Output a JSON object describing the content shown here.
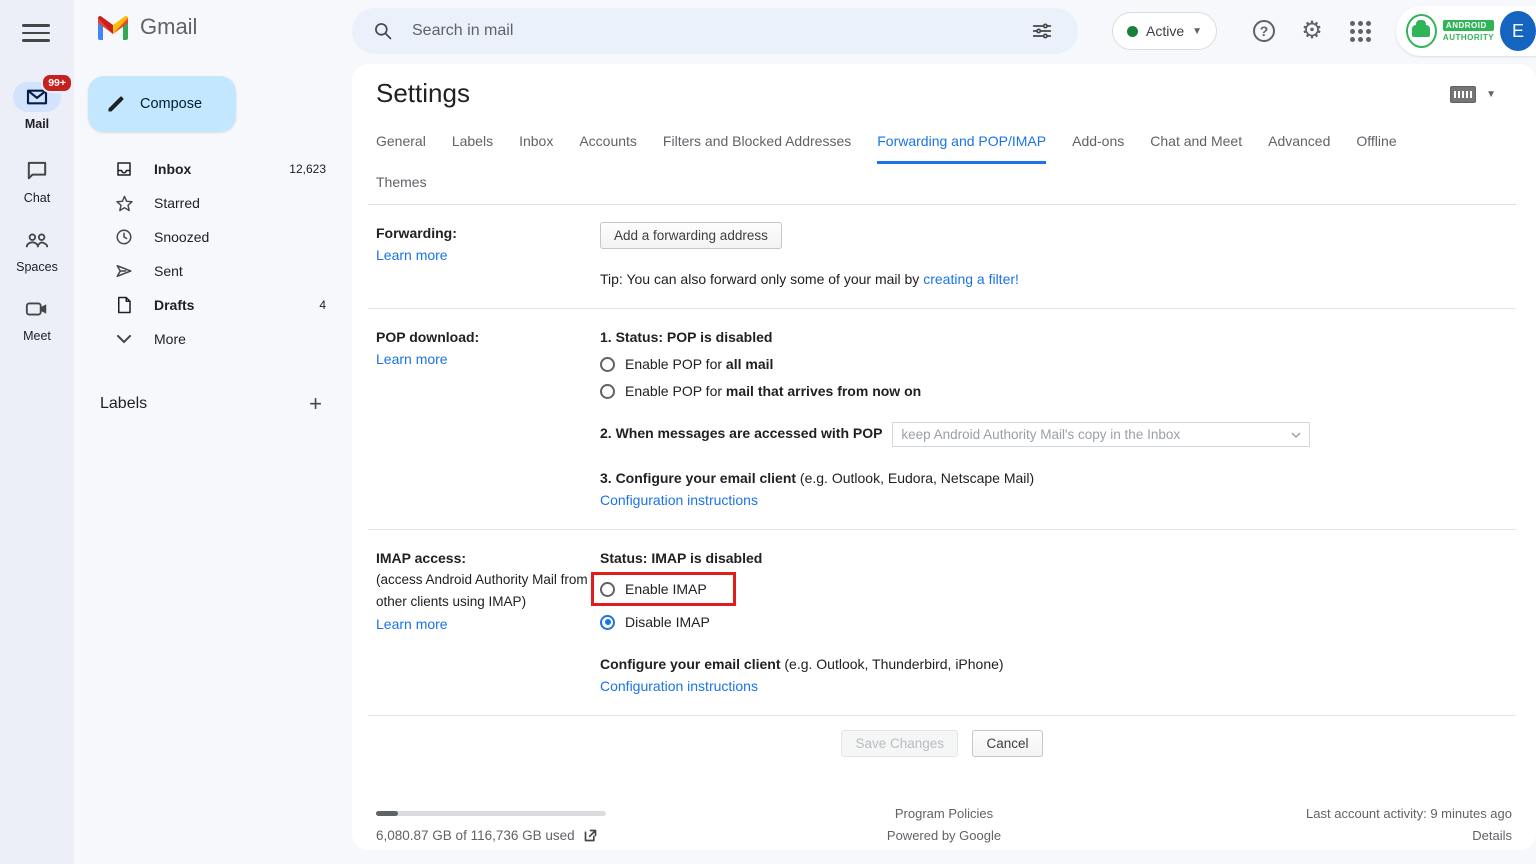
{
  "colors": {
    "accent_blue": "#1a73e8",
    "compose_blue": "#c2e7ff",
    "active_green": "#188038",
    "badge_red": "#c5221f",
    "highlight_red": "#e01d1d",
    "avatar_blue": "#1565c0",
    "brand_green": "#2fb457",
    "background": "#f6f8fc"
  },
  "brand": {
    "name": "Gmail"
  },
  "topbar": {
    "search_placeholder": "Search in mail",
    "active_label": "Active",
    "brand_line1": "ANDROID",
    "brand_line2": "AUTHORITY",
    "avatar_initial": "E"
  },
  "rail": {
    "mail_label": "Mail",
    "mail_badge": "99+",
    "chat_label": "Chat",
    "spaces_label": "Spaces",
    "meet_label": "Meet"
  },
  "sidebar": {
    "compose_label": "Compose",
    "items": [
      {
        "label": "Inbox",
        "count": "12,623"
      },
      {
        "label": "Starred",
        "count": ""
      },
      {
        "label": "Snoozed",
        "count": ""
      },
      {
        "label": "Sent",
        "count": ""
      },
      {
        "label": "Drafts",
        "count": "4"
      },
      {
        "label": "More",
        "count": ""
      }
    ],
    "labels_header": "Labels"
  },
  "settings": {
    "title": "Settings",
    "tabs": [
      "General",
      "Labels",
      "Inbox",
      "Accounts",
      "Filters and Blocked Addresses",
      "Forwarding and POP/IMAP",
      "Add-ons",
      "Chat and Meet",
      "Advanced",
      "Offline",
      "Themes"
    ],
    "active_tab": "Forwarding and POP/IMAP"
  },
  "forwarding": {
    "label": "Forwarding:",
    "learn_more": "Learn more",
    "button": "Add a forwarding address",
    "tip_prefix": "Tip: You can also forward only some of your mail by ",
    "tip_link": "creating a filter!"
  },
  "pop": {
    "label": "POP download:",
    "learn_more": "Learn more",
    "status": "1. Status: POP is disabled",
    "radio1_prefix": "Enable POP for ",
    "radio1_bold": "all mail",
    "radio2_prefix": "Enable POP for ",
    "radio2_bold": "mail that arrives from now on",
    "item2_label": "2. When messages are accessed with POP",
    "select_value": "keep Android Authority Mail's copy in the Inbox",
    "item3_bold": "3. Configure your email client",
    "item3_rest": " (e.g. Outlook, Eudora, Netscape Mail)",
    "config_link": "Configuration instructions"
  },
  "imap": {
    "label": "IMAP access:",
    "sub": "(access Android Authority Mail from other clients using IMAP)",
    "learn_more": "Learn more",
    "status": "Status: IMAP is disabled",
    "enable_label": "Enable IMAP",
    "disable_label": "Disable IMAP",
    "configure_bold": "Configure your email client",
    "configure_rest": " (e.g. Outlook, Thunderbird, iPhone)",
    "config_link": "Configuration instructions"
  },
  "actions": {
    "save": "Save Changes",
    "cancel": "Cancel"
  },
  "footer": {
    "storage": "6,080.87 GB of 116,736 GB used",
    "program_policies": "Program Policies",
    "powered_by": "Powered by Google",
    "last_activity": "Last account activity: 9 minutes ago",
    "details": "Details"
  }
}
